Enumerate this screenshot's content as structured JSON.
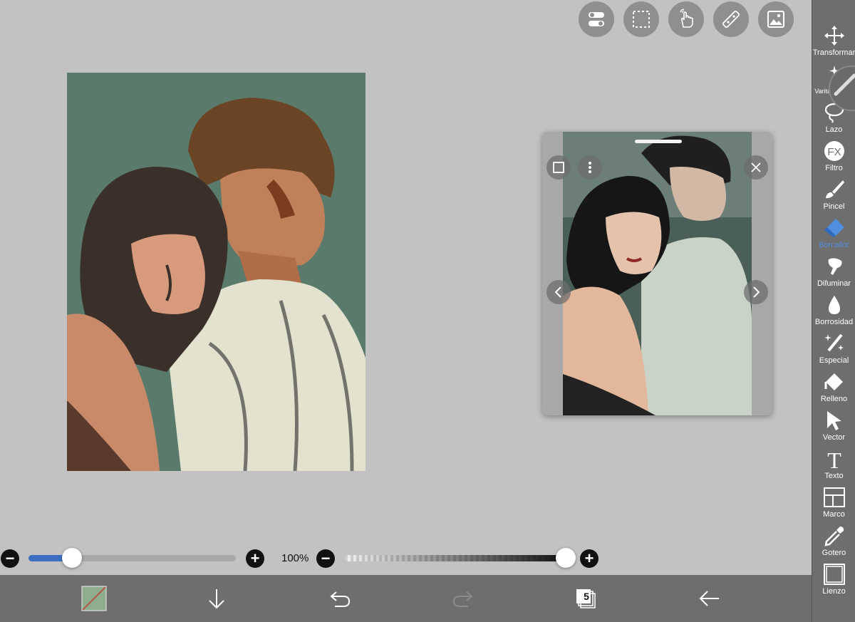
{
  "top_buttons": [
    {
      "name": "toggle-panels-button",
      "icon": "toggle-icon"
    },
    {
      "name": "selection-button",
      "icon": "selection-icon"
    },
    {
      "name": "touch-button",
      "icon": "hand-icon"
    },
    {
      "name": "ruler-button",
      "icon": "ruler-icon"
    },
    {
      "name": "image-button",
      "icon": "image-icon"
    }
  ],
  "toolbar": {
    "tools": [
      {
        "label": "Transformar",
        "icon": "move-icon"
      },
      {
        "label": "Varita mágica",
        "icon": "magic-wand-icon"
      },
      {
        "label": "Lazo",
        "icon": "lasso-icon"
      },
      {
        "label": "Filtro",
        "icon": "fx-icon"
      },
      {
        "label": "Pincel",
        "icon": "brush-icon"
      },
      {
        "label": "Borrador",
        "icon": "eraser-icon",
        "active": true
      },
      {
        "label": "Difuminar",
        "icon": "smudge-icon"
      },
      {
        "label": "Borrosidad",
        "icon": "blur-drop-icon"
      },
      {
        "label": "Especial",
        "icon": "sparkle-icon"
      },
      {
        "label": "Relleno",
        "icon": "fill-icon"
      },
      {
        "label": "Vector",
        "icon": "cursor-icon"
      },
      {
        "label": "Texto",
        "icon": "text-icon"
      },
      {
        "label": "Marco",
        "icon": "frame-icon"
      },
      {
        "label": "Gotero",
        "icon": "eyedropper-icon"
      },
      {
        "label": "Lienzo",
        "icon": "canvas-icon"
      }
    ],
    "accent_color": "#4f8fe0"
  },
  "sliders": {
    "brush_size_fraction": 0.21,
    "opacity_label": "100%",
    "opacity_fraction": 1.0,
    "fill_color": "#3d6ec2"
  },
  "bottom_bar": {
    "layer_count": "5",
    "color_swatch": "#8fae8d"
  },
  "colors": {
    "background": "#c2c2c2",
    "canvas_bg": "#5a7a6b",
    "bars": "#6e6e6e"
  }
}
